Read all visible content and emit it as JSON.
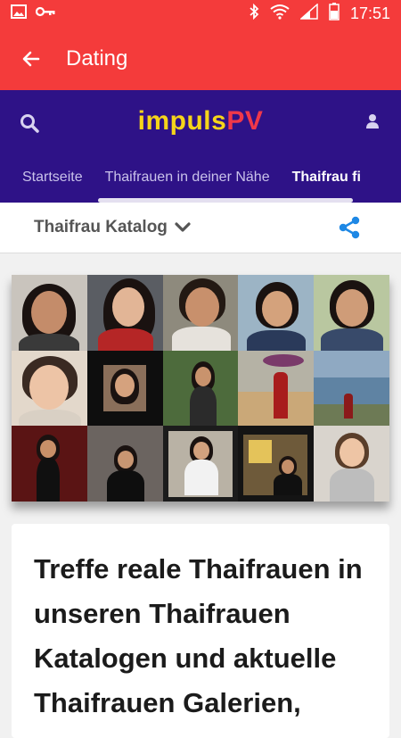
{
  "status": {
    "time": "17:51"
  },
  "appbar": {
    "title": "Dating"
  },
  "site": {
    "logo_main": "impuls",
    "logo_accent": "PV"
  },
  "tabs": [
    {
      "label": "Startseite"
    },
    {
      "label": "Thaifrauen in deiner Nähe"
    },
    {
      "label": "Thaifrau fi"
    }
  ],
  "catalog": {
    "title": "Thaifrau Katalog"
  },
  "card": {
    "heading": "Treffe reale Thaifrauen in unseren Thaifrauen Katalogen und aktuelle Thaifrauen Galerien,"
  },
  "colors": {
    "appbar": "#f43b3b",
    "header": "#2e1287",
    "share": "#1e88e5",
    "logo_yellow": "#f6d51a",
    "logo_red": "#f0384a"
  }
}
